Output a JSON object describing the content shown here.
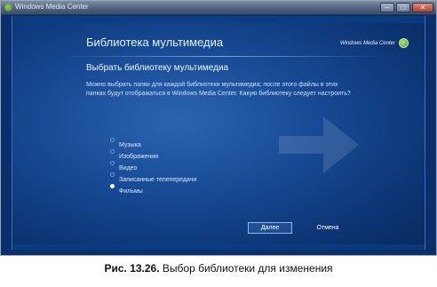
{
  "window": {
    "title": "Windows Media Center",
    "minimize_glyph": "–",
    "maximize_glyph": "□",
    "close_glyph": "✕"
  },
  "header": {
    "title": "Библиотека мультимедиа",
    "brand": "Windows Media Center"
  },
  "page": {
    "heading": "Выбрать библиотеку мультимедиа",
    "description": "Можно выбрать папки для каждой библиотеки мультимедиа; после этого файлы в этих папках будут отображаться в Windows Media Center. Какую библиотеку следует настроить?"
  },
  "options": [
    {
      "label": "Музыка",
      "checked": false
    },
    {
      "label": "Изображения",
      "checked": false
    },
    {
      "label": "Видео",
      "checked": false
    },
    {
      "label": "Записанные телепередачи",
      "checked": false
    },
    {
      "label": "Фильмы",
      "checked": true
    }
  ],
  "buttons": {
    "next": "Далее",
    "cancel": "Отмена"
  },
  "caption": {
    "number": "Рис. 13.26.",
    "text": " Выбор библиотеки для изменения"
  },
  "colors": {
    "background": "#174a94",
    "accent": "#8fb7ea"
  }
}
